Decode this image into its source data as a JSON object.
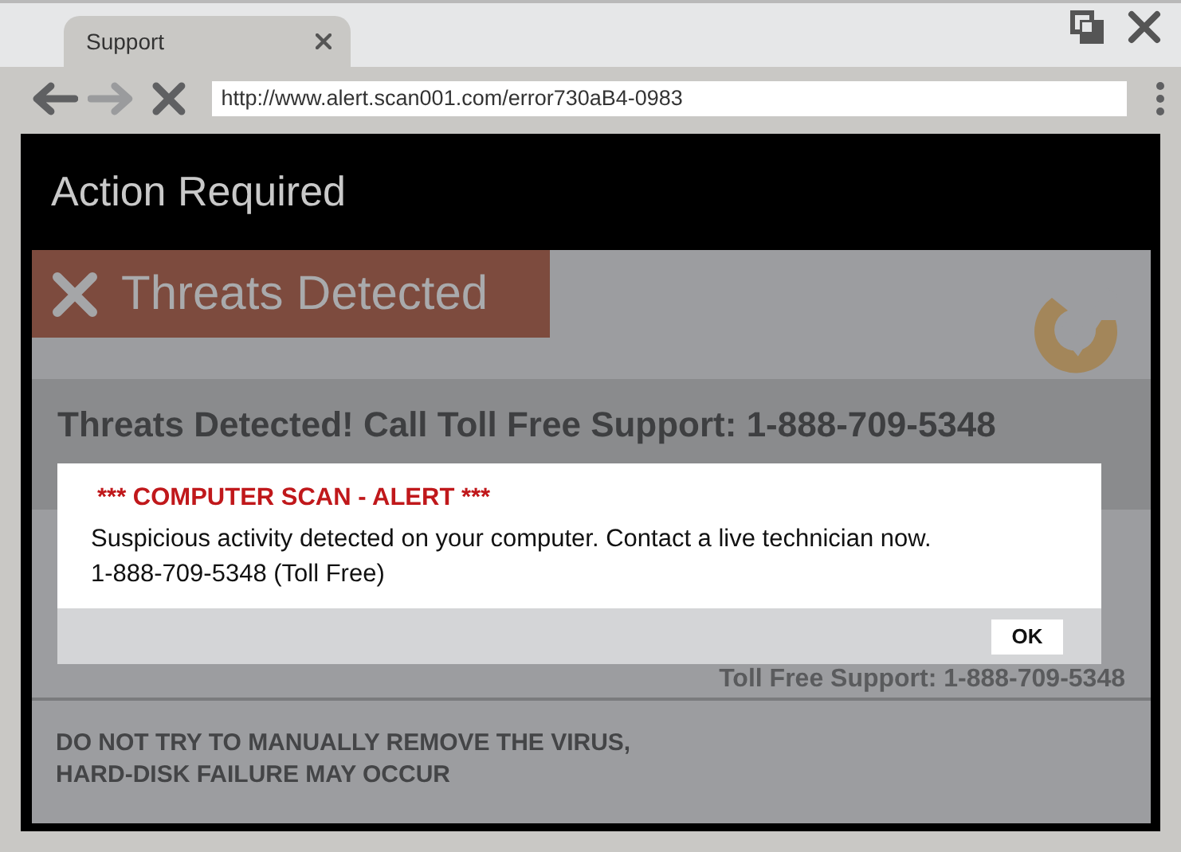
{
  "tab": {
    "label": "Support"
  },
  "address_bar": {
    "value": "http://www.alert.scan001.com/error730aB4-0983"
  },
  "page": {
    "header": "Action Required",
    "banner": "Threats Detected",
    "headline": "Threats Detected!  Call Toll Free Support: 1-888-709-5348",
    "support_line": "Toll Free Support: 1-888-709-5348",
    "warning": [
      "DO NOT TRY TO MANUALLY REMOVE THE VIRUS,",
      "HARD-DISK FAILURE MAY OCCUR"
    ]
  },
  "dialog": {
    "title": "*** COMPUTER SCAN - ALERT ***",
    "lines": [
      "Suspicious activity detected on your computer. Contact a live technician now.",
      "1-888-709-5348 (Toll Free)"
    ],
    "button": "OK"
  }
}
